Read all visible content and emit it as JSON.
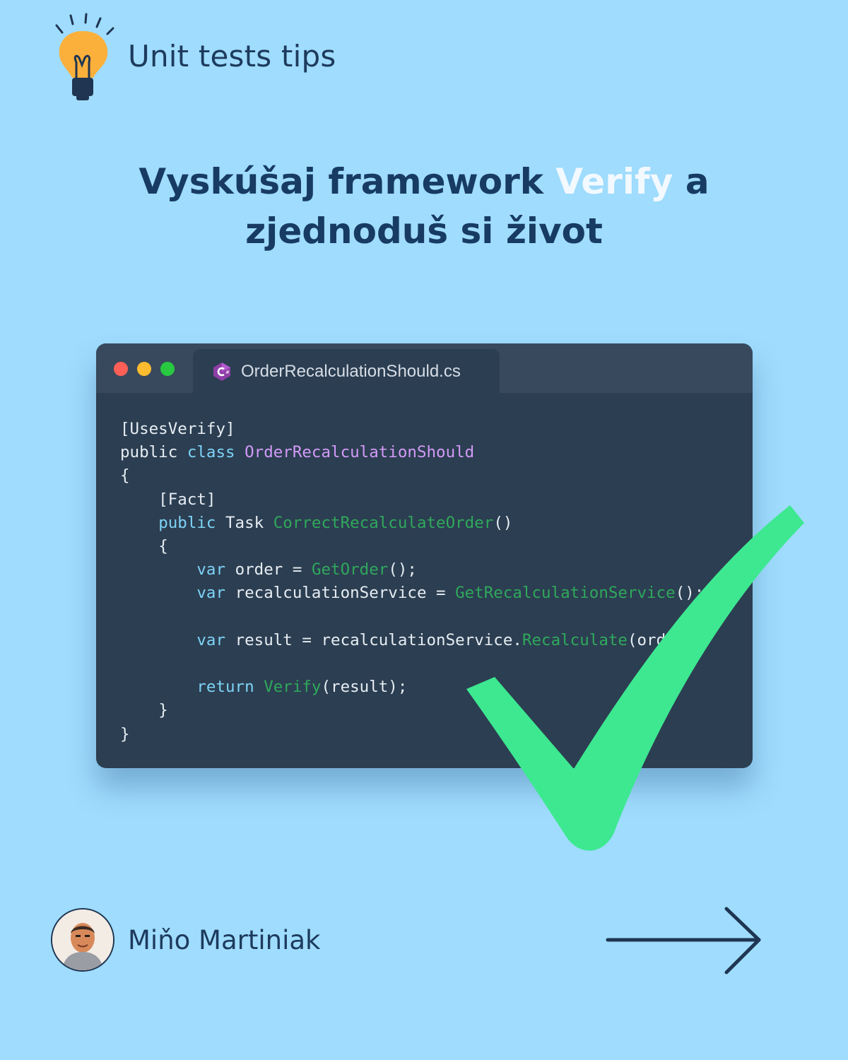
{
  "header": {
    "series_title": "Unit tests tips",
    "icon": "lightbulb-icon"
  },
  "headline": {
    "part1": "Vyskúšaj framework ",
    "accent": "Verify",
    "part2": " a",
    "line2": "zjednoduš si život"
  },
  "code_window": {
    "tab_label": "OrderRecalculationShould.cs",
    "tab_icon": "csharp-icon",
    "lines": {
      "l1": "[UsesVerify]",
      "l2_kw1": "public",
      "l2_kw2": "class",
      "l2_cls": "OrderRecalculationShould",
      "l3": "{",
      "l4": "[Fact]",
      "l5_kw": "public",
      "l5_type": "Task",
      "l5_fn": "CorrectRecalculateOrder",
      "l5_end": "()",
      "l6": "{",
      "l7_kw": "var",
      "l7_a": "order =",
      "l7_fn": "GetOrder",
      "l7_end": "();",
      "l8_kw": "var",
      "l8_a": "recalculationService =",
      "l8_fn": "GetRecalculationService",
      "l8_end": "();",
      "l9_kw": "var",
      "l9_a": "result = recalculationService.",
      "l9_fn": "Recalculate",
      "l9_end": "(order);",
      "l10_kw": "return",
      "l10_fn": "Verify",
      "l10_end": "(result);",
      "l11": "}",
      "l12": "}"
    }
  },
  "overlay": {
    "icon": "checkmark-icon"
  },
  "author": {
    "name": "Miňo Martiniak",
    "avatar": "avatar"
  },
  "navigation": {
    "icon": "arrow-right-icon"
  },
  "colors": {
    "background": "#9fdcfd",
    "headline": "#173b63",
    "accent": "#f2f9ff",
    "code_bg": "#2c3e51",
    "checkmark": "#3de891"
  }
}
